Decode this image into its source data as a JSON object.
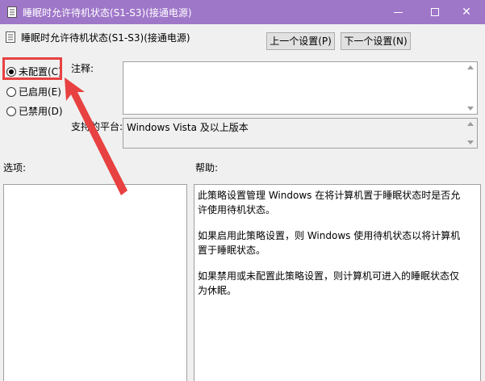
{
  "window": {
    "title": "睡眠时允许待机状态(S1-S3)(接通电源)",
    "title_bar_color": "#9f77c9"
  },
  "header": {
    "policy_title": "睡眠时允许待机状态(S1-S3)(接通电源)",
    "prev_button_label": "上一个设置(P)",
    "next_button_label": "下一个设置(N)"
  },
  "state_options": [
    {
      "label": "未配置(C)",
      "checked": true
    },
    {
      "label": "已启用(E)",
      "checked": false
    },
    {
      "label": "已禁用(D)",
      "checked": false
    }
  ],
  "comment": {
    "label": "注释:",
    "value": ""
  },
  "supported_on": {
    "label": "支持的平台:",
    "value": "Windows Vista 及以上版本"
  },
  "options": {
    "label": "选项:"
  },
  "help": {
    "label": "帮助:",
    "paragraphs": [
      "此策略设置管理 Windows 在将计算机置于睡眠状态时是否允许使用待机状态。",
      "如果启用此策略设置，则 Windows 使用待机状态以将计算机置于睡眠状态。",
      "如果禁用或未配置此策略设置，则计算机可进入的睡眠状态仅为休眠。"
    ]
  },
  "annotation": {
    "color": "#e84141"
  },
  "icons": {
    "app": "policy-document-icon",
    "minimize": "minimize-icon",
    "maximize": "maximize-icon",
    "close": "close-icon"
  }
}
